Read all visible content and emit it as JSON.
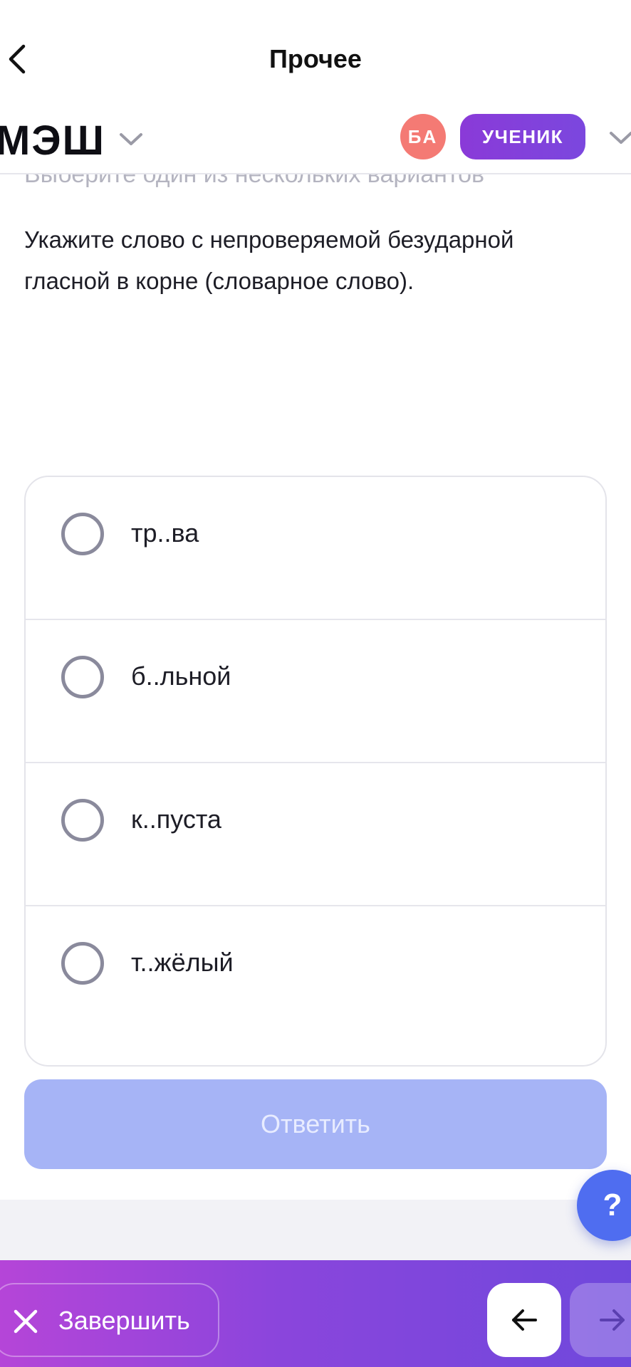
{
  "nav": {
    "title": "Прочее",
    "back_icon": "chevron-left-icon"
  },
  "header": {
    "logo": "МЭШ",
    "avatar_initials": "БА",
    "role": "УЧЕНИК",
    "colors": {
      "avatar": "#f47a74",
      "role": "#8a3ad8"
    }
  },
  "task": {
    "hint": "Выберите один из нескольких вариантов",
    "question": "Укажите слово с непроверяемой безударной гласной в корне (словарное слово).",
    "options": [
      {
        "label": "тр..ва",
        "selected": false
      },
      {
        "label": "б..льной",
        "selected": false
      },
      {
        "label": "к..пуста",
        "selected": false
      },
      {
        "label": "т..жёлый",
        "selected": false
      }
    ],
    "answer_label": "Ответить",
    "answer_enabled": false
  },
  "help": {
    "label": "?"
  },
  "footer": {
    "finish_label": "Завершить",
    "prev_icon": "arrow-left-icon",
    "next_icon": "arrow-right-icon"
  }
}
